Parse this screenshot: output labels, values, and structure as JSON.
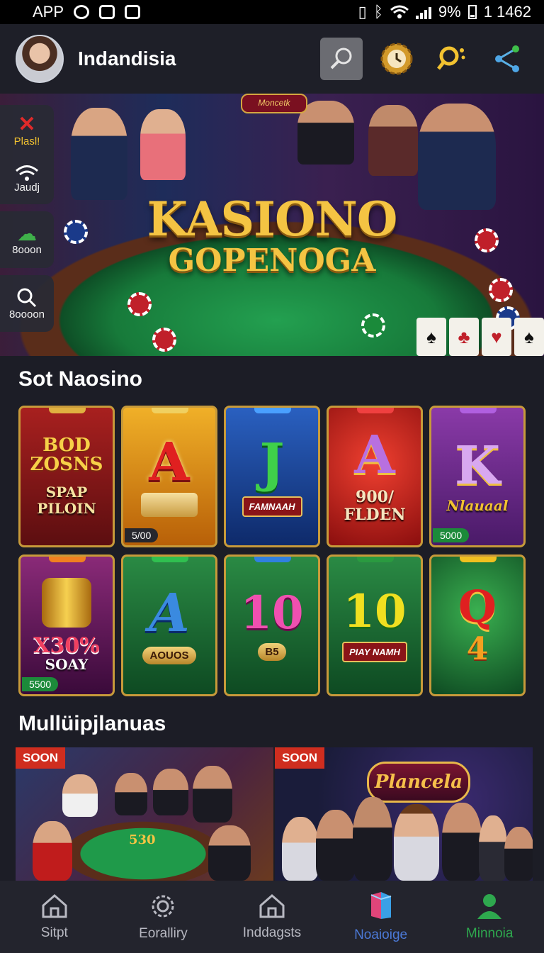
{
  "status_bar": {
    "app_label": "APP",
    "battery": "9%",
    "time": "1 1462"
  },
  "header": {
    "app_name": "Indandisia"
  },
  "hero": {
    "logo_text": "Moncetk",
    "title_line1": "KASIONO",
    "title_line2": "GOPENOGA",
    "cards": [
      "♠",
      "♣",
      "♥",
      "♠",
      "♥"
    ]
  },
  "side_dock": [
    {
      "label": "Plasl!",
      "icon": "close-icon"
    },
    {
      "label": "Jaudj",
      "icon": "wifi-icon"
    },
    {
      "label": "8ooon",
      "icon": "cloud-icon"
    },
    {
      "label": "8oooon",
      "icon": "search-icon"
    }
  ],
  "slot_section": {
    "title": "Sot Naosino",
    "games": [
      {
        "symbol": "",
        "big": "BOD ZOSNS",
        "sub": "SPAP PILOIN",
        "badge": "",
        "bg": "#8e1a1a",
        "tab": "#e0b040"
      },
      {
        "symbol": "A",
        "big": "",
        "sub": "",
        "badge": "5/00",
        "bg": "#d88a12",
        "tab": "#f0d060"
      },
      {
        "symbol": "J",
        "big": "",
        "sub": "FAMNAAH",
        "badge": "",
        "bg": "#1c4a9c",
        "tab": "#4aa0ff"
      },
      {
        "symbol": "A",
        "big": "",
        "sub": "900/ FLDEN",
        "badge": "",
        "bg": "#b81c1c",
        "tab": "#f04040"
      },
      {
        "symbol": "K",
        "big": "",
        "sub": "Nlauaal",
        "badge": "5000",
        "bg": "#6a2a8a",
        "tab": "#b060e0"
      },
      {
        "symbol": "",
        "big": "X30%",
        "sub": "SOAY",
        "badge": "5500",
        "bg": "#6a1a5a",
        "tab": "#f08020"
      },
      {
        "symbol": "A",
        "big": "",
        "sub": "",
        "plate": "AOUOS",
        "badge": "",
        "bg": "#1a6a30",
        "tab": "#30c050"
      },
      {
        "symbol": "10",
        "big": "",
        "sub": "",
        "plate": "B5",
        "badge": "",
        "bg": "#1a6a30",
        "tab": "#3080e0"
      },
      {
        "symbol": "10",
        "big": "",
        "sub": "",
        "ribbon": "PIAY NAMH",
        "badge": "",
        "bg": "#1a6a30",
        "tab": "#2a9a40"
      },
      {
        "symbol": "Q",
        "big": "4",
        "sub": "",
        "badge": "",
        "bg": "#1a7a34",
        "tab": "#f0c020"
      }
    ]
  },
  "multi_section": {
    "title": "Mullüipjlanuas",
    "cards": [
      {
        "badge": "SOON",
        "logo": "",
        "label": "530"
      },
      {
        "badge": "SOON",
        "logo": "Plancela",
        "label": ""
      }
    ]
  },
  "bottom_nav": [
    {
      "label": "Sitpt",
      "icon": "home-icon",
      "state": "normal"
    },
    {
      "label": "Eoralliry",
      "icon": "gear-icon",
      "state": "normal"
    },
    {
      "label": "Inddagsts",
      "icon": "house-icon",
      "state": "normal"
    },
    {
      "label": "Noaioige",
      "icon": "cube-icon",
      "state": "active-blue"
    },
    {
      "label": "Minnoia",
      "icon": "profile-icon",
      "state": "active-green"
    }
  ],
  "colors": {
    "background": "#1c1d26",
    "accent_gold": "#f4c443",
    "soon_red": "#cf2d1f",
    "nav_blue": "#4b79d6",
    "nav_green": "#2ea84e"
  }
}
